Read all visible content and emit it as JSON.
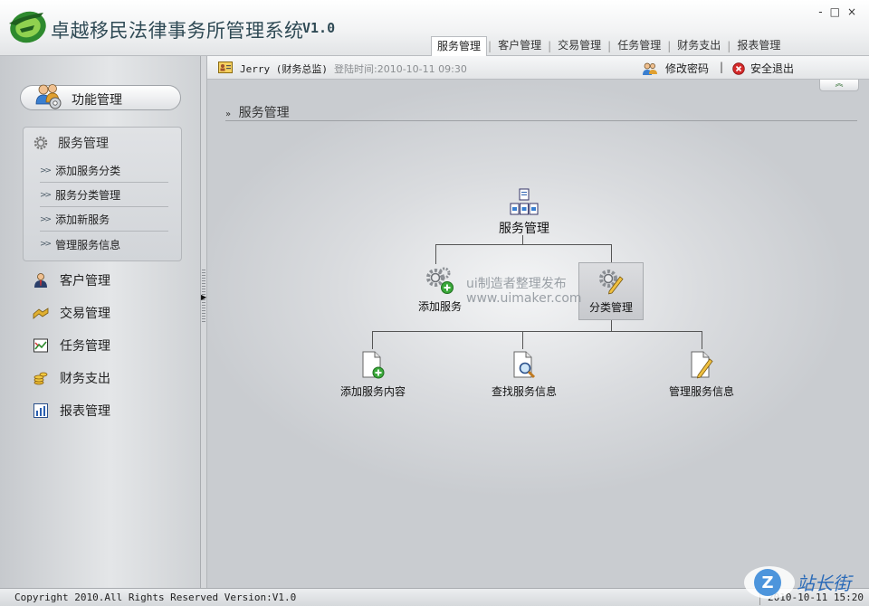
{
  "app": {
    "title": "卓越移民法律事务所管理系统",
    "version": "V1.0"
  },
  "window_controls": {
    "minimize": "-",
    "maximize": "□",
    "close": "×"
  },
  "top_nav": [
    {
      "label": "服务管理",
      "active": true
    },
    {
      "label": "客户管理",
      "active": false
    },
    {
      "label": "交易管理",
      "active": false
    },
    {
      "label": "任务管理",
      "active": false
    },
    {
      "label": "财务支出",
      "active": false
    },
    {
      "label": "报表管理",
      "active": false
    }
  ],
  "nav_separator": "|",
  "infobar": {
    "user": "Jerry (财务总监)",
    "login_time": "登陆时间:2010-10-11 09:30",
    "change_password": "修改密码",
    "separator": "|",
    "logout": "安全退出"
  },
  "sidebar": {
    "header": "功能管理",
    "group": {
      "title": "服务管理",
      "items": [
        "添加服务分类",
        "服务分类管理",
        "添加新服务",
        "管理服务信息"
      ]
    },
    "items": [
      {
        "label": "客户管理",
        "icon": "customer-icon"
      },
      {
        "label": "交易管理",
        "icon": "transaction-icon"
      },
      {
        "label": "任务管理",
        "icon": "task-icon"
      },
      {
        "label": "财务支出",
        "icon": "finance-icon"
      },
      {
        "label": "报表管理",
        "icon": "report-icon"
      }
    ]
  },
  "breadcrumb": "服务管理",
  "breadcrumb_arrow": "»",
  "tree": {
    "root": "服务管理",
    "level1": [
      "添加服务",
      "分类管理"
    ],
    "level2": [
      "添加服务内容",
      "查找服务信息",
      "管理服务信息"
    ]
  },
  "watermark": {
    "line1": "ui制造者整理发布",
    "line2": "www.uimaker.com"
  },
  "footer": {
    "copyright": "Copyright 2010.All Rights Reserved Version:V1.0",
    "date": "2010-10-11 15:20"
  },
  "site_logo_text": "站长街",
  "colors": {
    "accent_green": "#3a9a3a",
    "title_text": "#2f4a55",
    "logout_red": "#d42a2a"
  }
}
